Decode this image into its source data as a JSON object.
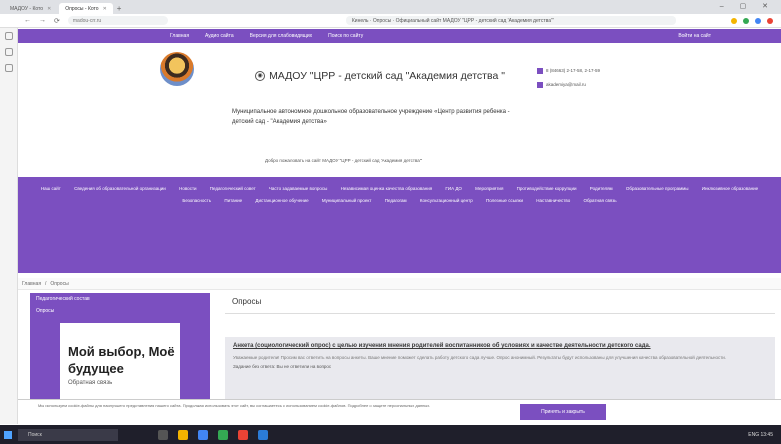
{
  "browser": {
    "tabs": [
      "МАДОУ - Кото",
      "Опросы - Кото"
    ],
    "new_tab": "+",
    "win_controls": "– ▢ ✕",
    "url_short": "madou-crr.ru",
    "breadcrumb_url": "Кинель · Опросы · Официальный сайт МАДОУ \"ЦРР - детский сад 'Академия детства'\"",
    "ext_colors": [
      "#f4b400",
      "#34a853",
      "#4285f4",
      "#ea4335"
    ]
  },
  "topnav": {
    "items": [
      "Главная",
      "Аудио сайта",
      "Версия для слабовидящих",
      "Поиск по сайту"
    ],
    "login": "Войти на сайт"
  },
  "header": {
    "title": "МАДОУ \"ЦРР - детский сад \"Академия детства \"",
    "description": "Муниципальное автономное дошкольное образовательное учреждение «Центр развития ребенка - детский сад - \"Академия детства»",
    "subtitle": "Добро пожаловать на сайт МАДОУ \"ЦРР - детский сад 'Академия детства'\"",
    "contact_phone": "8 (84663) 2-17-58, 2-17-59",
    "contact_email": "akademiya@mail.ru"
  },
  "megamenu": {
    "items": [
      "Наш сайт",
      "Сведения об образовательной организации",
      "Новости",
      "Педагогический совет",
      "Часто задаваемые вопросы",
      "Независимая оценка качества образования",
      "ГИА ДО",
      "Мероприятия",
      "Противодействие коррупции",
      "Родителям",
      "Образовательные программы",
      "Инклюзивное образование",
      "Безопасность",
      "Питание",
      "Дистанционное обучение",
      "Муниципальный проект",
      "Педагогам",
      "Консультационный центр",
      "Полезные ссылки",
      "Наставничество",
      "Обратная связь"
    ]
  },
  "breadcrumb": [
    "Главная",
    "Опросы"
  ],
  "sidebar": {
    "items": [
      "Педагогический состав",
      "Опросы"
    ],
    "promo_title": "Мой выбор, Моё будущее",
    "promo_sub": "Обратная связь"
  },
  "main": {
    "title": "Опросы",
    "poll_title": "Анкета (социологический опрос) с целью изучения мнения родителей воспитанников об условиях и качестве деятельности детского сада.",
    "poll_text": "Уважаемые родители! Просим вас ответить на вопросы анкеты. Ваше мнение поможет сделать работу детского сада лучше. Опрос анонимный. Результаты будут использованы для улучшения качества образовательной деятельности.",
    "poll_meta": "Задание без ответа: Вы не ответили на вопрос"
  },
  "cookie": {
    "text": "Мы используем cookie-файлы для наилучшего представления нашего сайта. Продолжая использовать этот сайт, вы соглашаетесь с использованием cookie-файлов. Подробнее о защите персональных данных.",
    "button": "Принять и закрыть"
  },
  "taskbar": {
    "search": "Поиск",
    "tray": "ENG 13:45"
  }
}
